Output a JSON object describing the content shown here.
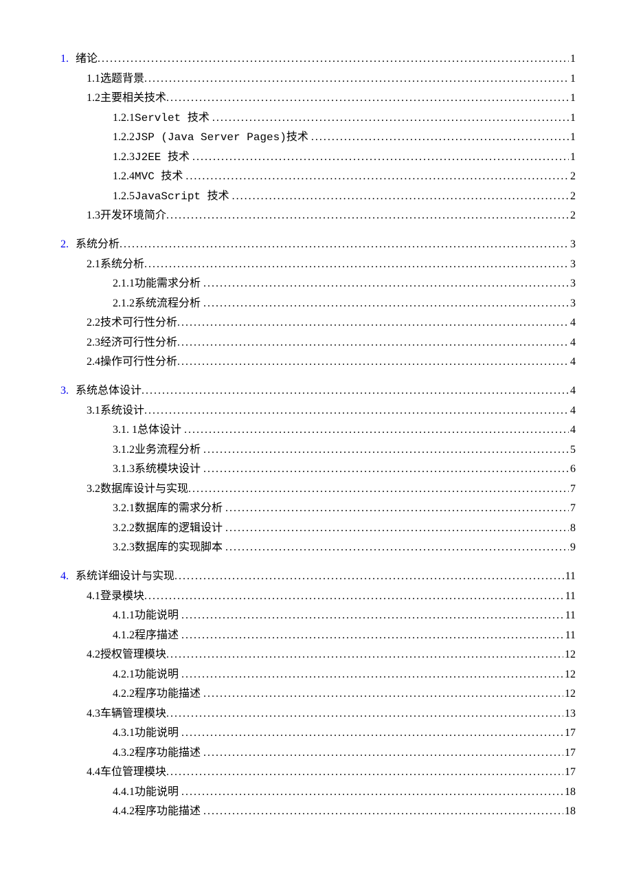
{
  "toc": [
    {
      "num": "1.",
      "title": "绪论",
      "page": "1",
      "children": [
        {
          "num": "1.1",
          "title": "选题背景",
          "page": "1",
          "children": []
        },
        {
          "num": "1.2",
          "title": "主要相关技术",
          "page": "1",
          "children": [
            {
              "num": "1.2.1",
              "title": "Servlet 技术",
              "page": "1",
              "mono": true
            },
            {
              "num": "1.2.2",
              "title": "JSP (Java Server Pages)技术",
              "page": "1",
              "mono": true
            },
            {
              "num": "1.2.3",
              "title": "J2EE 技术",
              "page": "1",
              "mono": true
            },
            {
              "num": "1.2.4",
              "title": "MVC 技术",
              "page": "2",
              "mono": true
            },
            {
              "num": "1.2.5",
              "title": "JavaScript 技术",
              "page": "2",
              "mono": true
            }
          ]
        },
        {
          "num": "1.3",
          "title": "开发环境简介",
          "page": "2",
          "children": []
        }
      ]
    },
    {
      "num": "2.",
      "title": "系统分析",
      "page": "3",
      "children": [
        {
          "num": "2.1",
          "title": "系统分析",
          "page": "3",
          "children": [
            {
              "num": "2.1.1",
              "title": "功能需求分析",
              "page": "3"
            },
            {
              "num": "2.1.2",
              "title": "系统流程分析",
              "page": "3"
            }
          ]
        },
        {
          "num": "2.2",
          "title": "技术可行性分析",
          "page": "4",
          "children": []
        },
        {
          "num": "2.3",
          "title": "经济可行性分析",
          "page": "4",
          "children": []
        },
        {
          "num": "2.4",
          "title": "操作可行性分析",
          "page": "4",
          "children": []
        }
      ]
    },
    {
      "num": "3.",
      "title": "系统总体设计",
      "page": "4",
      "children": [
        {
          "num": "3.1",
          "title": "系统设计",
          "page": "4",
          "children": [
            {
              "num": "3.1. 1",
              "title": "总体设计",
              "page": "4"
            },
            {
              "num": "3.1.2",
              "title": "业务流程分析",
              "page": "5"
            },
            {
              "num": "3.1.3",
              "title": "系统模块设计",
              "page": "6"
            }
          ]
        },
        {
          "num": "3.2",
          "title": "数据库设计与实现",
          "page": "7",
          "children": [
            {
              "num": "3.2.1",
              "title": "数据库的需求分析",
              "page": "7"
            },
            {
              "num": "3.2.2",
              "title": "数据库的逻辑设计",
              "page": "8"
            },
            {
              "num": "3.2.3",
              "title": "数据库的实现脚本",
              "page": "9"
            }
          ]
        }
      ]
    },
    {
      "num": "4.",
      "title": "系统详细设计与实现",
      "page": "11",
      "children": [
        {
          "num": "4.1",
          "title": "登录模块",
          "page": "11",
          "children": [
            {
              "num": "4.1.1",
              "title": "功能说明",
              "page": "11"
            },
            {
              "num": "4.1.2",
              "title": "程序描述",
              "page": "11"
            }
          ]
        },
        {
          "num": "4.2",
          "title": "授权管理模块",
          "page": "12",
          "children": [
            {
              "num": "4.2.1",
              "title": "功能说明",
              "page": "12"
            },
            {
              "num": "4.2.2",
              "title": "程序功能描述",
              "page": "12"
            }
          ]
        },
        {
          "num": "4.3",
          "title": "车辆管理模块",
          "page": "13",
          "children": [
            {
              "num": "4.3.1",
              "title": "功能说明",
              "page": "17"
            },
            {
              "num": "4.3.2",
              "title": "程序功能描述",
              "page": "17"
            }
          ]
        },
        {
          "num": "4.4",
          "title": "车位管理模块",
          "page": "17",
          "children": [
            {
              "num": "4.4.1",
              "title": "功能说明",
              "page": "18"
            },
            {
              "num": "4.4.2",
              "title": "程序功能描述",
              "page": "18"
            }
          ]
        }
      ]
    }
  ]
}
